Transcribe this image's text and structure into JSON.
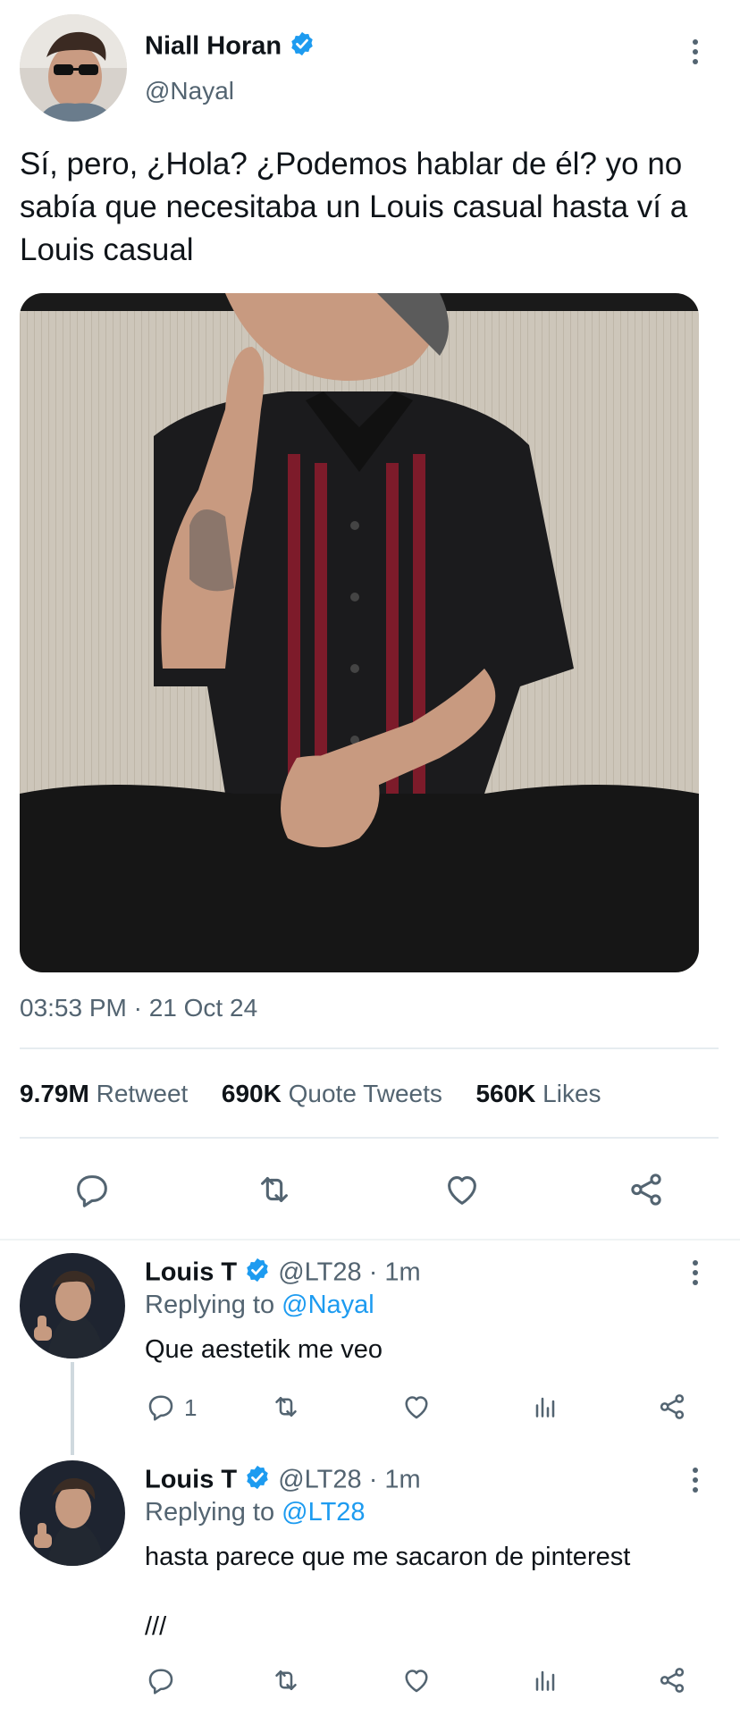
{
  "tweet": {
    "author_name": "Niall Horan",
    "author_handle": "@Nayal",
    "text": "Sí, pero, ¿Hola? ¿Podemos hablar de él? yo no sabía que necesitaba un Louis casual hasta ví a Louis casual",
    "timestamp": "03:53 PM · 21 Oct 24",
    "stats": {
      "retweets_count": "9.79M",
      "retweets_label": "Retweet",
      "quotes_count": "690K",
      "quotes_label": "Quote Tweets",
      "likes_count": "560K",
      "likes_label": "Likes"
    }
  },
  "replies": [
    {
      "name": "Louis T",
      "handle": "@LT28",
      "time": "· 1m",
      "replying_prefix": "Replying to",
      "replying_to": "@Nayal",
      "text": "Que aestetik me veo",
      "reply_count": "1"
    },
    {
      "name": "Louis T",
      "handle": "@LT28",
      "time": "· 1m",
      "replying_prefix": "Replying to",
      "replying_to": "@LT28",
      "text": "hasta parece que me sacaron de pinterest",
      "text2": "///",
      "reply_count": ""
    }
  ],
  "colors": {
    "accent": "#1d9bf0",
    "muted": "#536471",
    "verified": "#1d9bf0"
  }
}
